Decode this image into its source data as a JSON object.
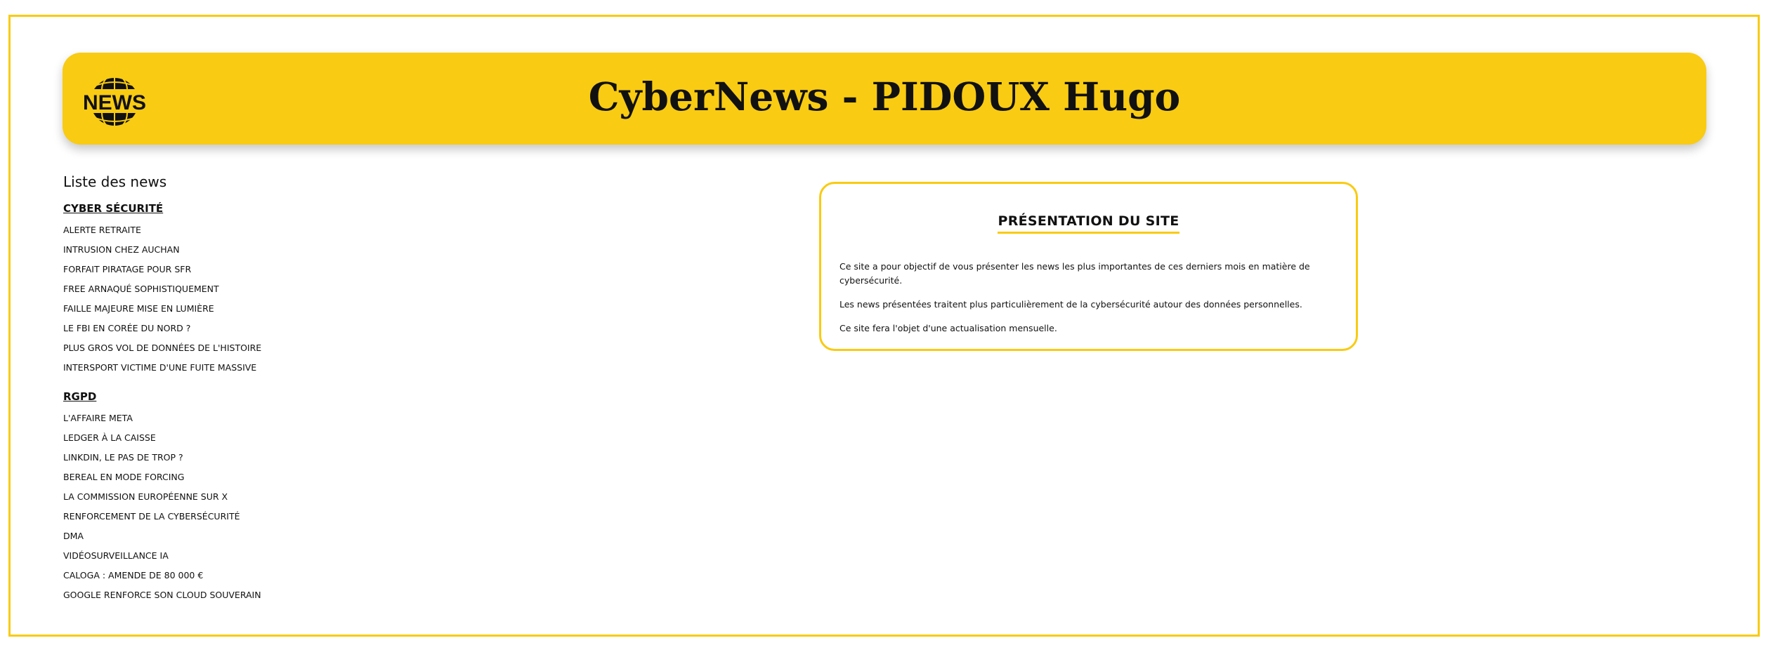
{
  "header": {
    "title": "CyberNews - PIDOUX Hugo",
    "logo_text": "NEWS",
    "logo_icon": "globe-news-icon",
    "accent_color": "#f9cb12"
  },
  "sidebar": {
    "heading": "Liste des news",
    "categories": [
      {
        "title": "Cyber sécurité",
        "items": [
          "Alerte retraite",
          "Intrusion chez Auchan",
          "Forfait piratage pour SFR",
          "Free arnaqué sophistiquement",
          "Faille majeure mise en lumière",
          "Le FBI en Corée du Nord ?",
          "Plus gros vol de données de l'histoire",
          "Intersport victime d'une fuite massive"
        ]
      },
      {
        "title": "RGPD",
        "items": [
          "L'affaire Meta",
          "Ledger à la caisse",
          "LinkDin, le pas de trop ?",
          "BeReal en mode forcing",
          "La commission européenne sur X",
          "Renforcement de la cybersécurité",
          "DMA",
          "Vidéosurveillance IA",
          "Caloga : amende de 80 000 €",
          "Google renforce son cloud souverain"
        ]
      }
    ]
  },
  "presentation": {
    "title": "PRÉSENTATION DU SITE",
    "paragraphs": [
      "Ce site a pour objectif de vous présenter les news les plus importantes de ces derniers mois en matière de cybersécurité.",
      "Les news présentées traitent plus particulièrement de la cybersécurité autour des données personnelles.",
      "Ce site fera l'objet d'une actualisation mensuelle."
    ]
  }
}
